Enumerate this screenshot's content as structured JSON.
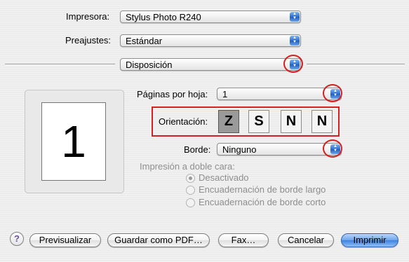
{
  "printer": {
    "label": "Impresora:",
    "value": "Stylus Photo R240"
  },
  "presets": {
    "label": "Preajustes:",
    "value": "Estándar"
  },
  "panel": {
    "value": "Disposición"
  },
  "layout": {
    "pages_per_sheet": {
      "label": "Páginas por hoja:",
      "value": "1"
    },
    "orientation": {
      "label": "Orientación:",
      "options": [
        "Z",
        "S",
        "N",
        "N"
      ],
      "selected_index": 0
    },
    "border": {
      "label": "Borde:",
      "value": "Ninguno"
    },
    "preview_number": "1"
  },
  "duplex": {
    "label": "Impresión a doble cara:",
    "options": [
      "Desactivado",
      "Encuadernación de borde largo",
      "Encuadernación de borde corto"
    ],
    "selected_index": 0,
    "enabled": false
  },
  "buttons": {
    "help": "?",
    "preview": "Previsualizar",
    "save_pdf": "Guardar como PDF…",
    "fax": "Fax…",
    "cancel": "Cancelar",
    "print": "Imprimir"
  },
  "colors": {
    "annotation": "#d42020",
    "accent": "#3d82e0"
  }
}
